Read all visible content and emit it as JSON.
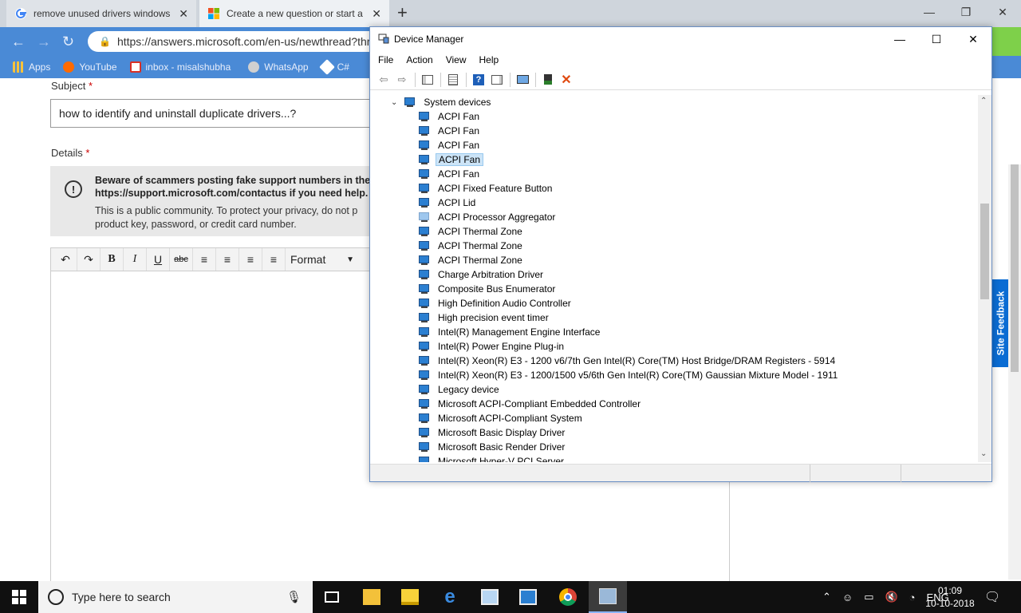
{
  "browser": {
    "tabs": [
      {
        "title": "remove unused drivers windows",
        "favicon": "google-icon"
      },
      {
        "title": "Create a new question or start a",
        "favicon": "microsoft-icon"
      }
    ],
    "url": "https://answers.microsoft.com/en-us/newthread?thr",
    "bookmarks": [
      {
        "label": "Apps",
        "icon": "apps-grid-icon"
      },
      {
        "label": "YouTube",
        "icon": "youtube-icon"
      },
      {
        "label": "inbox - misalshubha",
        "icon": "gmail-icon"
      },
      {
        "label": "WhatsApp",
        "icon": "whatsapp-icon"
      },
      {
        "label": "C#",
        "icon": "csharp-icon"
      }
    ]
  },
  "page": {
    "subject_label": "Subject",
    "subject_value": "how to identify and uninstall duplicate drivers...?",
    "details_label": "Details",
    "required_mark": "*",
    "notice_bold": "Beware of scammers posting fake support numbers in the https://support.microsoft.com/contactus if you need help.",
    "notice_text": "This is a public community. To protect your privacy, do not p product key, password, or credit card number.",
    "format_label": "Format",
    "site_feedback": "Site Feedback"
  },
  "device_manager": {
    "title": "Device Manager",
    "menu": [
      "File",
      "Action",
      "View",
      "Help"
    ],
    "category": "System devices",
    "devices": [
      "ACPI Fan",
      "ACPI Fan",
      "ACPI Fan",
      "ACPI Fan",
      "ACPI Fan",
      "ACPI Fixed Feature Button",
      "ACPI Lid",
      "ACPI Processor Aggregator",
      "ACPI Thermal Zone",
      "ACPI Thermal Zone",
      "ACPI Thermal Zone",
      "Charge Arbitration Driver",
      "Composite Bus Enumerator",
      "High Definition Audio Controller",
      "High precision event timer",
      "Intel(R) Management Engine Interface",
      "Intel(R) Power Engine Plug-in",
      "Intel(R) Xeon(R) E3 - 1200 v6/7th Gen Intel(R) Core(TM) Host Bridge/DRAM Registers - 5914",
      "Intel(R) Xeon(R) E3 - 1200/1500 v5/6th Gen Intel(R) Core(TM) Gaussian Mixture Model - 1911",
      "Legacy device",
      "Microsoft ACPI-Compliant Embedded Controller",
      "Microsoft ACPI-Compliant System",
      "Microsoft Basic Display Driver",
      "Microsoft Basic Render Driver",
      "Microsoft Hyper-V PCI Server"
    ],
    "selected_index": 3,
    "faded_index": 7
  },
  "taskbar": {
    "search_placeholder": "Type here to search",
    "language": "ENG",
    "time": "01:09",
    "date": "10-10-2018"
  },
  "colors": {
    "chrome_blue": "#4a8ad6",
    "selection": "#cce4f7",
    "site_feedback": "#0b6cd3",
    "taskbar": "#101010"
  }
}
